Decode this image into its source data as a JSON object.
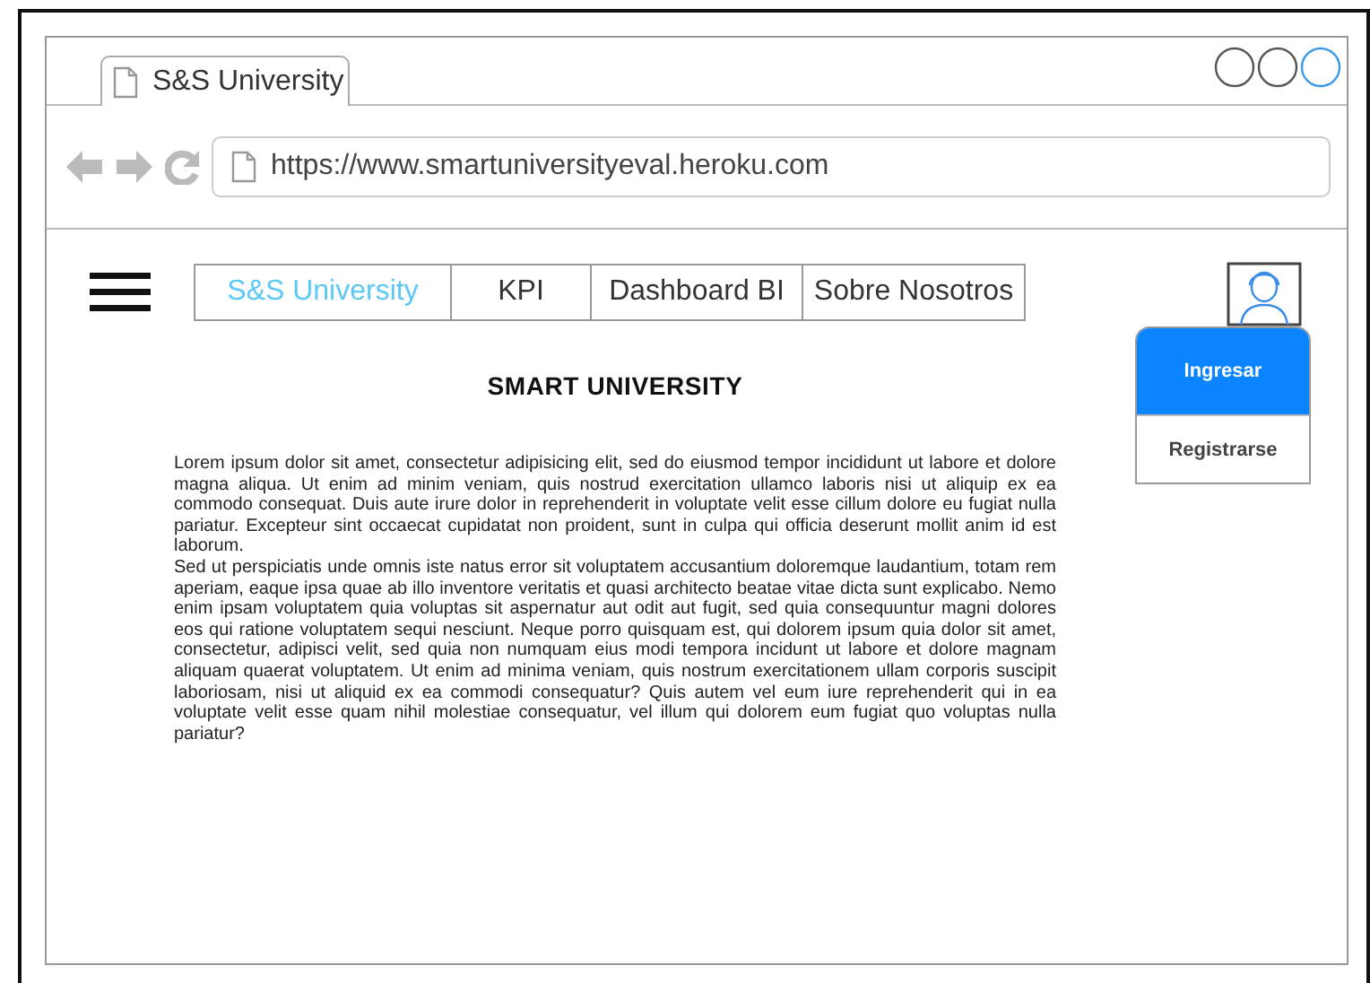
{
  "browser": {
    "tab_title": "S&S University",
    "url": "https://www.smartuniversityeval.heroku.com",
    "window_controls": [
      {
        "selected": false
      },
      {
        "selected": false
      },
      {
        "selected": true
      }
    ]
  },
  "nav": {
    "items": [
      {
        "label": "S&S University",
        "selected": true
      },
      {
        "label": "KPI",
        "selected": false
      },
      {
        "label": "Dashboard BI",
        "selected": false
      },
      {
        "label": "Sobre Nosotros",
        "selected": false
      }
    ]
  },
  "user_menu": {
    "items": [
      {
        "label": "Ingresar",
        "selected": true
      },
      {
        "label": "Registrarse",
        "selected": false
      }
    ]
  },
  "content": {
    "heading": "SMART UNIVERSITY",
    "paragraphs": [
      "Lorem ipsum dolor sit amet, consectetur adipisicing elit, sed do eiusmod tempor incididunt ut labore et dolore magna aliqua. Ut enim ad minim veniam, quis nostrud exercitation ullamco laboris nisi ut aliquip ex ea commodo consequat. Duis aute irure dolor in reprehenderit in voluptate velit esse cillum dolore eu fugiat nulla pariatur. Excepteur sint occaecat cupidatat non proident, sunt in culpa qui officia deserunt mollit anim id est laborum.",
      "Sed ut perspiciatis unde omnis iste natus error sit voluptatem accusantium doloremque laudantium, totam rem aperiam, eaque ipsa quae ab illo inventore veritatis et quasi architecto beatae vitae dicta sunt explicabo. Nemo enim ipsam voluptatem quia voluptas sit aspernatur aut odit aut fugit, sed quia consequuntur magni dolores eos qui ratione voluptatem sequi nesciunt. Neque porro quisquam est, qui dolorem ipsum quia dolor sit amet, consectetur, adipisci velit, sed quia non numquam eius modi tempora incidunt ut labore et dolore magnam aliquam quaerat voluptatem. Ut enim ad minima veniam, quis nostrum exercitationem ullam corporis suscipit laboriosam, nisi ut aliquid ex ea commodi consequatur? Quis autem vel eum iure reprehenderit qui in ea voluptate velit esse quam nihil molestiae consequatur, vel illum qui dolorem eum fugiat quo voluptas nulla pariatur?"
    ]
  }
}
